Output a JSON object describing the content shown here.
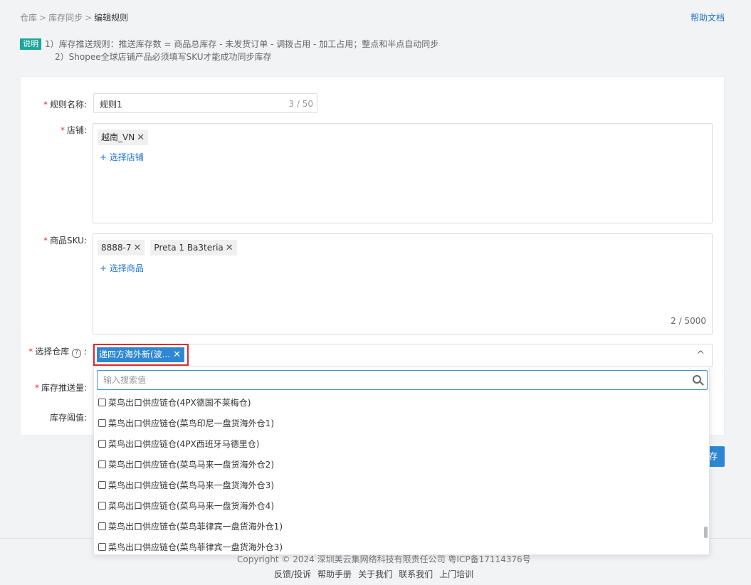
{
  "breadcrumb": {
    "items": [
      "仓库",
      "库存同步",
      "编辑规则"
    ],
    "sep": ">"
  },
  "help_link": "帮助文档",
  "note": {
    "badge": "说明",
    "line1": "1）库存推送规则：推送库存数 = 商品总库存 - 未发货订单 - 调拨占用 - 加工占用；整点和半点自动同步",
    "line2": "2）Shopee全球店铺产品必须填写SKU才能成功同步库存"
  },
  "form": {
    "rule_name": {
      "label": "规则名称:",
      "value": "规则1",
      "count": "3 / 50"
    },
    "shop": {
      "label": "店铺:",
      "tags": [
        "越南_VN"
      ],
      "add_label": "+ 选择店铺"
    },
    "sku": {
      "label": "商品SKU:",
      "tags": [
        "8888-7",
        "Preta 1 Ba3teria"
      ],
      "add_label": "+ 选择商品",
      "count": "2 / 5000"
    },
    "warehouse": {
      "label": "选择仓库",
      "help_icon": "?",
      "colon": ":",
      "selected": "递四方海外新(波...",
      "chevron": "^"
    },
    "push_qty": {
      "label": "库存推送量:"
    },
    "threshold": {
      "label": "库存阈值:"
    }
  },
  "save_button": "存",
  "dropdown": {
    "search_placeholder": "输入搜索值",
    "options": [
      "菜鸟出口供应链仓(4PX德国不莱梅仓)",
      "菜鸟出口供应链仓(菜鸟印尼一盘货海外仓1)",
      "菜鸟出口供应链仓(4PX西班牙马德里仓)",
      "菜鸟出口供应链仓(菜鸟马来一盘货海外仓2)",
      "菜鸟出口供应链仓(菜鸟马来一盘货海外仓3)",
      "菜鸟出口供应链仓(菜鸟马来一盘货海外仓4)",
      "菜鸟出口供应链仓(菜鸟菲律宾一盘货海外仓1)",
      "菜鸟出口供应链仓(菜鸟菲律宾一盘货海外仓3)"
    ],
    "scroll_position": 0.85
  },
  "footer": {
    "copyright": "Copyright © 2024 深圳美云集网络科技有限责任公司 粤ICP备17114376号",
    "links": [
      "反馈/投诉",
      "帮助手册",
      "关于我们",
      "联系我们",
      "上门培训"
    ]
  },
  "colors": {
    "primary": "#2e87d5",
    "required": "#e33333",
    "highlight": "#e32828",
    "badge": "#1ba79b"
  }
}
